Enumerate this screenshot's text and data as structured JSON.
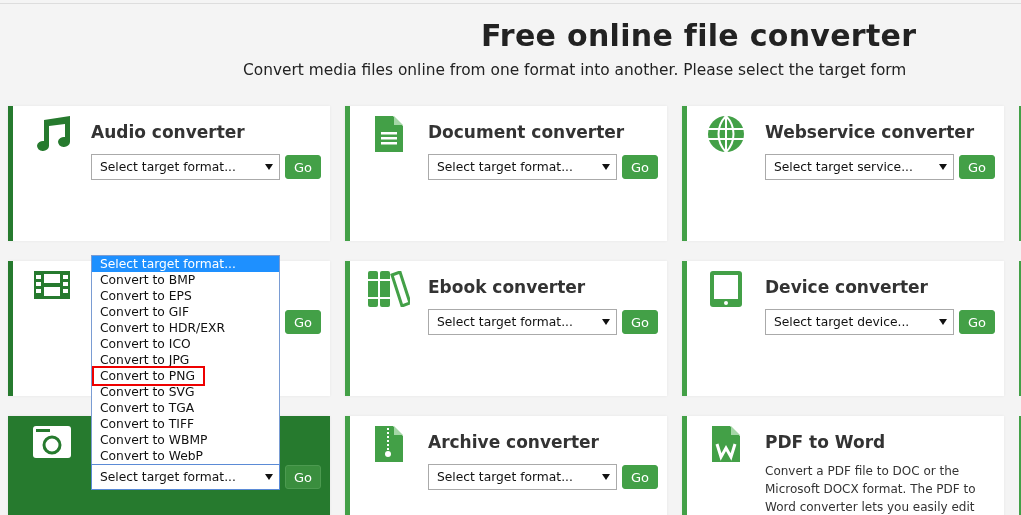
{
  "header": {
    "title": "Free online file converter",
    "subtitle": "Convert media files online from one format into another. Please select the target form"
  },
  "cards": [
    {
      "title": "Audio converter",
      "select": "Select target format...",
      "go": "Go",
      "highlighted": false,
      "open": false
    },
    {
      "title": "Document converter",
      "select": "Select target format...",
      "go": "Go",
      "highlighted": false,
      "open": false
    },
    {
      "title": "Webservice converter",
      "select": "Select target service...",
      "go": "Go",
      "highlighted": false,
      "open": false
    },
    {
      "go": "Go",
      "highlighted": false
    },
    {
      "title": "Ebook converter",
      "select": "Select target format...",
      "go": "Go",
      "highlighted": false,
      "open": false
    },
    {
      "title": "Device converter",
      "select": "Select target device...",
      "go": "Go",
      "highlighted": false,
      "open": false
    },
    {
      "select": "Select target format...",
      "go": "Go",
      "highlighted": true,
      "open": true
    },
    {
      "title": "Archive converter",
      "select": "Select target format...",
      "go": "Go",
      "highlighted": false,
      "open": false
    },
    {
      "title": "PDF to Word",
      "description": "Convert a PDF file to DOC or the Microsoft DOCX format. The PDF to Word converter lets you easily edit",
      "highlighted": false
    }
  ],
  "dropdown": {
    "options": [
      {
        "label": "Select target format...",
        "selected": true,
        "marked": false
      },
      {
        "label": "Convert to BMP",
        "selected": false,
        "marked": false
      },
      {
        "label": "Convert to EPS",
        "selected": false,
        "marked": false
      },
      {
        "label": "Convert to GIF",
        "selected": false,
        "marked": false
      },
      {
        "label": "Convert to HDR/EXR",
        "selected": false,
        "marked": false
      },
      {
        "label": "Convert to ICO",
        "selected": false,
        "marked": false
      },
      {
        "label": "Convert to JPG",
        "selected": false,
        "marked": false
      },
      {
        "label": "Convert to PNG",
        "selected": false,
        "marked": true
      },
      {
        "label": "Convert to SVG",
        "selected": false,
        "marked": false
      },
      {
        "label": "Convert to TGA",
        "selected": false,
        "marked": false
      },
      {
        "label": "Convert to TIFF",
        "selected": false,
        "marked": false
      },
      {
        "label": "Convert to WBMP",
        "selected": false,
        "marked": false
      },
      {
        "label": "Convert to WebP",
        "selected": false,
        "marked": false
      }
    ]
  }
}
